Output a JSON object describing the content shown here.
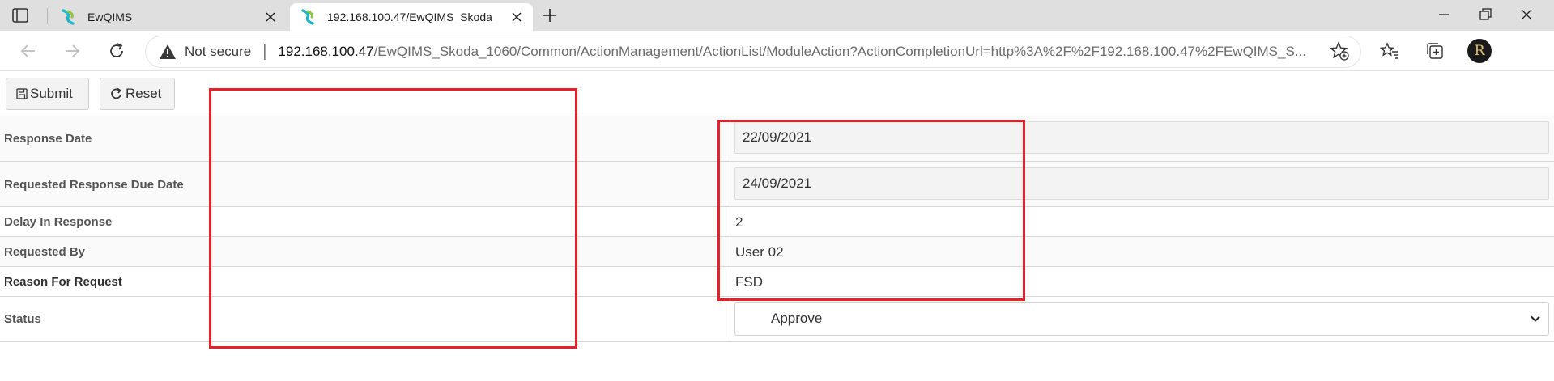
{
  "browser": {
    "tabs": [
      {
        "title": "EwQIMS"
      },
      {
        "title": "192.168.100.47/EwQIMS_Skoda_"
      }
    ],
    "security_label": "Not secure",
    "url_host": "192.168.100.47",
    "url_rest": "/EwQIMS_Skoda_1060/Common/ActionManagement/ActionList/ModuleAction?ActionCompletionUrl=http%3A%2F%2F192.168.100.47%2FEwQIMS_S...",
    "profile_initials": "R"
  },
  "toolbar": {
    "submit_label": "Submit",
    "reset_label": "Reset"
  },
  "form": {
    "response_date": {
      "label": "Response Date",
      "value": "22/09/2021"
    },
    "requested_response_due_date": {
      "label": "Requested Response Due Date",
      "value": "24/09/2021"
    },
    "delay_in_response": {
      "label": "Delay In Response",
      "value": "2"
    },
    "requested_by": {
      "label": "Requested By",
      "value": "User 02"
    },
    "reason_for_request": {
      "label": "Reason For Request",
      "value": "FSD"
    },
    "status": {
      "label": "Status",
      "value": "Approve"
    }
  },
  "colors": {
    "annotation": "#e8202a",
    "favicon_teal": "#1fb6c9",
    "favicon_green": "#8cc63f"
  }
}
